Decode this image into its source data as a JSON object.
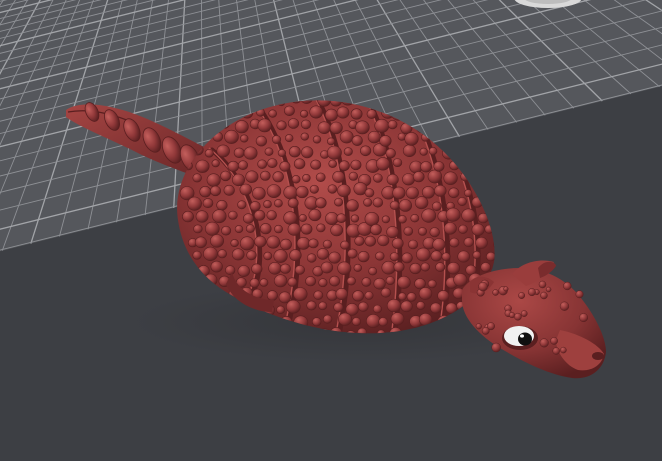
{
  "viewport": {
    "label": "",
    "colors": {
      "background": "#3d3f44",
      "plate": "#55575c",
      "grid_line": "#8e9095",
      "grid_major": "#a2a4a8",
      "model_base": "#8a3434",
      "model_dark": "#5a1f20",
      "model_light": "#b5514f",
      "eye_white": "#f1f1f1",
      "eye_pupil": "#101010",
      "corner_marker": "#d9d9d9"
    },
    "model": {
      "name": "",
      "icon": "armadillo-model-icon"
    },
    "corner_marker": {
      "icon": "bed-corner-marker-icon"
    }
  }
}
